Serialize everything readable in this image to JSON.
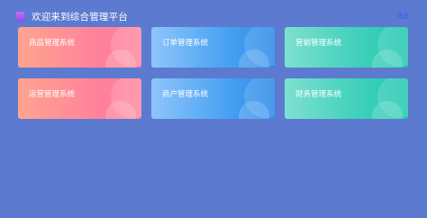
{
  "header": {
    "title": "欢迎来到综合管理平台",
    "logout_label": "退出"
  },
  "cards": [
    {
      "label": "商品管理系统"
    },
    {
      "label": "订单管理系统"
    },
    {
      "label": "营销管理系统"
    },
    {
      "label": "运营管理系统"
    },
    {
      "label": "商户管理系统"
    },
    {
      "label": "财务管理系统"
    }
  ],
  "colors": {
    "background": "#5c7ad0",
    "card_red": "#ff7f9c",
    "card_blue": "#2b8ae8",
    "card_teal": "#22c8b0",
    "logout": "#2d5cf6"
  }
}
